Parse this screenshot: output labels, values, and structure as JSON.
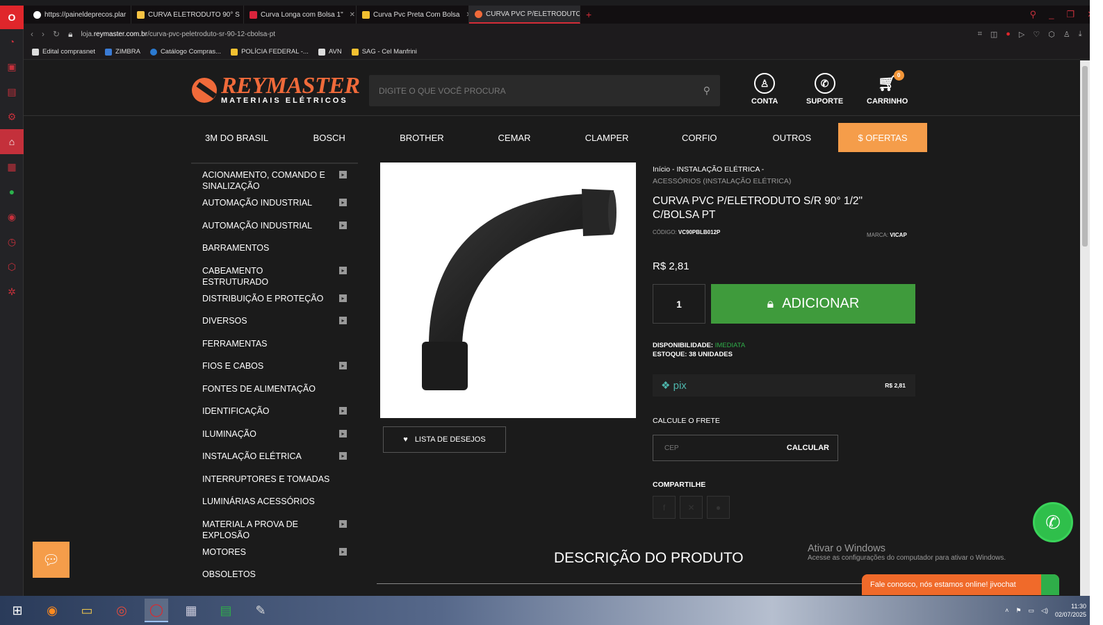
{
  "browser": {
    "tabs": [
      {
        "title": "https://paineldeprecos.plar",
        "color": "#ffffff",
        "active": false
      },
      {
        "title": "CURVA ELETRODUTO 90° S",
        "color": "#f6c343",
        "active": false
      },
      {
        "title": "Curva Longa com Bolsa 1\"",
        "color": "#d9243c",
        "active": false
      },
      {
        "title": "Curva Pvc Preta Com Bolsa",
        "color": "#f2c030",
        "active": false
      },
      {
        "title": "CURVA PVC P/ELETRODUTO",
        "color": "#f06a3a",
        "active": true
      }
    ],
    "new_tab": "+",
    "url_prefix": "loja.",
    "url_domain": "reymaster.com.br",
    "url_path": "/curva-pvc-peletroduto-sr-90-12-cbolsa-pt",
    "bookmarks": [
      {
        "label": "Edital comprasnet",
        "color": "#dddddd"
      },
      {
        "label": "ZIMBRA",
        "color": "#3a7bd5"
      },
      {
        "label": "Catálogo Compras...",
        "color": "#2b7ad1"
      },
      {
        "label": "POLÍCIA FEDERAL -...",
        "color": "#f2c030"
      },
      {
        "label": "AVN",
        "color": "#dddddd"
      },
      {
        "label": "SAG - Cel Manfrini",
        "color": "#f2c030"
      }
    ]
  },
  "site": {
    "brand_name": "REYMASTER",
    "brand_sub": "MATERIAIS ELÉTRICOS",
    "search_placeholder": "DIGITE O QUE VOCÊ PROCURA",
    "header_links": {
      "account": "CONTA",
      "support": "SUPORTE",
      "cart": "CARRINHO",
      "cart_count": "0"
    },
    "categories": [
      "3M DO BRASIL",
      "BOSCH",
      "BROTHER",
      "CEMAR",
      "CLAMPER",
      "CORFIO",
      "OUTROS"
    ],
    "offers_label": "$ OFERTAS",
    "side_menu": [
      {
        "label": "ACIONAMENTO, COMANDO E SINALIZAÇÃO",
        "arrow": true
      },
      {
        "label": "AUTOMAÇÃO INDUSTRIAL",
        "arrow": true
      },
      {
        "label": "AUTOMAÇÃO INDUSTRIAL",
        "arrow": true
      },
      {
        "label": "BARRAMENTOS",
        "arrow": false
      },
      {
        "label": "CABEAMENTO ESTRUTURADO",
        "arrow": true
      },
      {
        "label": "DISTRIBUIÇÃO E PROTEÇÃO",
        "arrow": true
      },
      {
        "label": "DIVERSOS",
        "arrow": true
      },
      {
        "label": "FERRAMENTAS",
        "arrow": false
      },
      {
        "label": "FIOS E CABOS",
        "arrow": true
      },
      {
        "label": "FONTES DE ALIMENTAÇÃO",
        "arrow": false
      },
      {
        "label": "IDENTIFICAÇÃO",
        "arrow": true
      },
      {
        "label": "ILUMINAÇÃO",
        "arrow": true
      },
      {
        "label": "INSTALAÇÃO ELÉTRICA",
        "arrow": true
      },
      {
        "label": "INTERRUPTORES E TOMADAS",
        "arrow": false
      },
      {
        "label": "LUMINÁRIAS ACESSÓRIOS",
        "arrow": false
      },
      {
        "label": "MATERIAL A PROVA DE EXPLOSÃO",
        "arrow": true
      },
      {
        "label": "MOTORES",
        "arrow": true
      },
      {
        "label": "OBSOLETOS",
        "arrow": false
      }
    ]
  },
  "product": {
    "breadcrumb_home": "Início",
    "breadcrumb_sep": " - ",
    "breadcrumb_cat": "INSTALAÇÃO ELÉTRICA",
    "breadcrumb_sub": "ACESSÓRIOS (INSTALAÇÃO ELÉTRICA)",
    "title": "CURVA PVC P/ELETRODUTO S/R 90° 1/2\" C/BOLSA PT",
    "code_label": "CÓDIGO: ",
    "code": "VC90PBLB012P",
    "brand_label": "MARCA: ",
    "brand": "VICAP",
    "price": "R$ 2,81",
    "quantity": "1",
    "add_label": "ADICIONAR",
    "availability_label": "DISPONIBILIDADE: ",
    "availability": "IMEDIATA",
    "stock": "ESTOQUE: 38 UNIDADES",
    "pix_label": "pix",
    "pix_price": "R$ 2,81",
    "wishlist_label": "LISTA DE DESEJOS",
    "shipping_label": "CALCULE O FRETE",
    "cep_placeholder": "CEP",
    "calc_label": "CALCULAR",
    "share_label": "COMPARTILHE",
    "description_title": "DESCRIÇÃO DO PRODUTO"
  },
  "overlay": {
    "activate_title": "Ativar o Windows",
    "activate_sub": "Acesse as configurações do computador para ativar o Windows.",
    "chat_text": "Fale conosco, nós estamos online!",
    "chat_brand": "jivochat"
  },
  "taskbar": {
    "time": "11:30",
    "date": "02/07/2025"
  },
  "colors": {
    "accent": "#f06a3a",
    "offers": "#f59d4a",
    "add_button": "#3f9b3c",
    "available": "#2fae49",
    "opera_red": "#e0262b"
  }
}
